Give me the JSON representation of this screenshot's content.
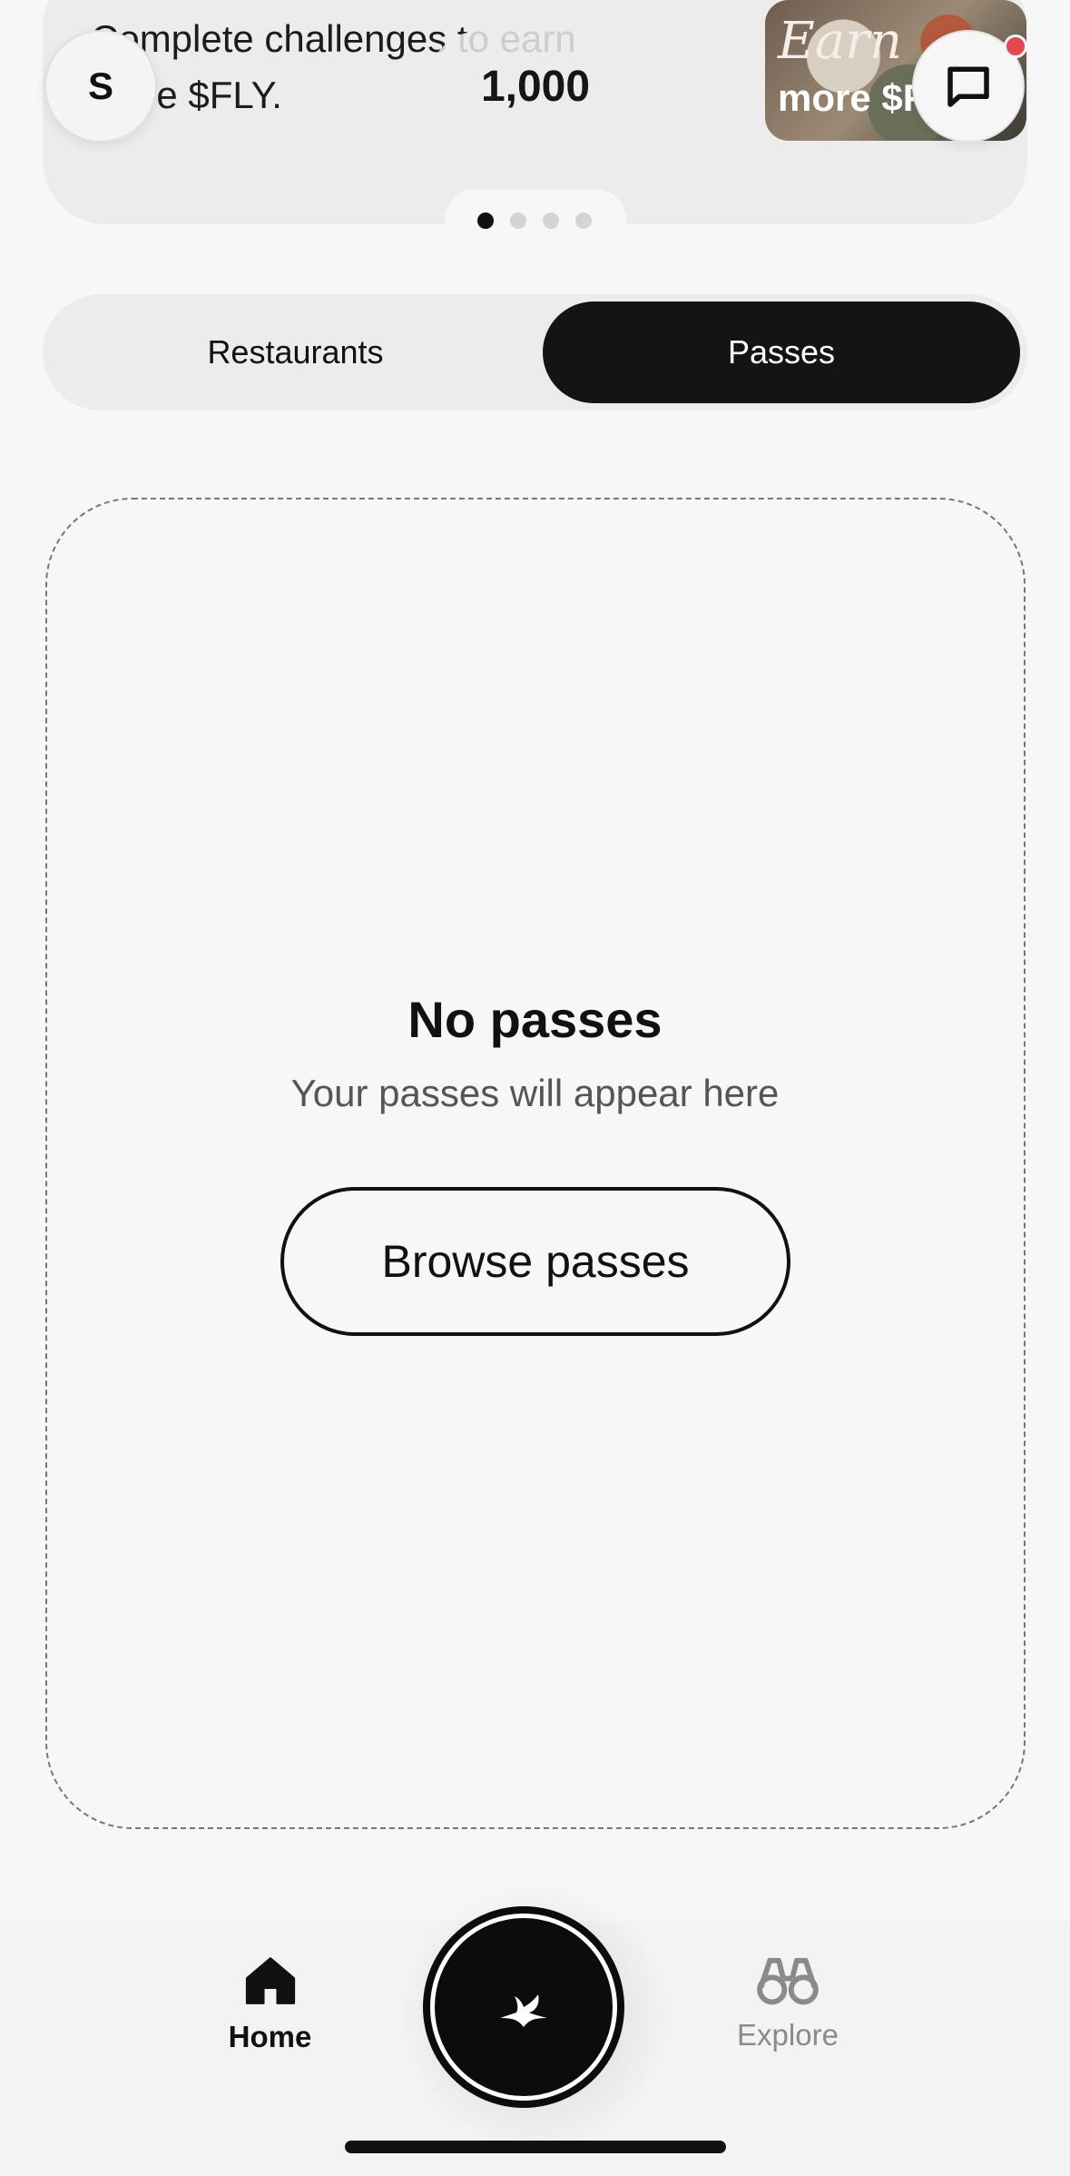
{
  "promo": {
    "text": "Complete challenges to earn more $FLY.",
    "image_script": "Earn",
    "image_bold": "more $FLY",
    "carousel_total": 4,
    "carousel_active": 1
  },
  "header": {
    "avatar_initial": "S",
    "points": "1,000",
    "chat_icon": "message-square-icon",
    "has_notification": true
  },
  "tabs": {
    "restaurants_label": "Restaurants",
    "passes_label": "Passes",
    "selected": "Passes"
  },
  "empty_state": {
    "title": "No passes",
    "subtitle": "Your passes will appear here",
    "button_label": "Browse passes"
  },
  "bottom_nav": {
    "home_label": "Home",
    "explore_label": "Explore",
    "active": "Home",
    "center_icon": "blackbird-logo-icon"
  },
  "colors": {
    "accent": "#141414",
    "notification": "#e5484d",
    "background": "#f7f7f7"
  }
}
